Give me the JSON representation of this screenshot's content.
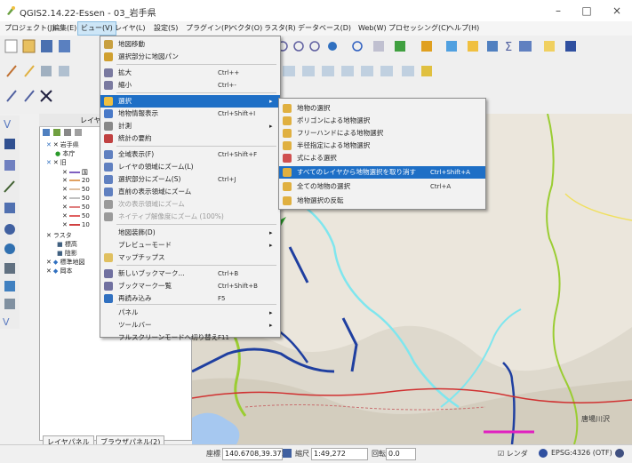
{
  "window": {
    "title": "QGIS2.14.22-Essen - 03_岩手県",
    "controls": [
      "–",
      "□",
      "×"
    ]
  },
  "menubar": [
    {
      "label": "プロジェクト(J)"
    },
    {
      "label": "編集(E)"
    },
    {
      "label": "ビュー(V)",
      "active": true
    },
    {
      "label": "レイヤ(L)"
    },
    {
      "label": "設定(S)"
    },
    {
      "label": "プラグイン(P)"
    },
    {
      "label": "ベクタ(O)"
    },
    {
      "label": "ラスタ(R)"
    },
    {
      "label": "データベース(D)"
    },
    {
      "label": "Web(W)"
    },
    {
      "label": "プロセッシング(C)"
    },
    {
      "label": "ヘルプ(H)"
    }
  ],
  "view_menu": {
    "items": [
      {
        "label": "地図移動",
        "icon": "pan-icon",
        "color": "#c8a040"
      },
      {
        "label": "選択部分に地図パン",
        "icon": "pan-selection-icon",
        "color": "#d0a030"
      },
      {
        "label": "拡大",
        "icon": "zoom-in-icon",
        "color": "#7a7aa0",
        "shortcut": "Ctrl++"
      },
      {
        "label": "縮小",
        "icon": "zoom-out-icon",
        "color": "#7a7aa0",
        "shortcut": "Ctrl+-"
      },
      {
        "label": "選択",
        "icon": "select-icon",
        "color": "#f0c040",
        "submenu": true,
        "highlighted": true
      },
      {
        "label": "地物情報表示",
        "icon": "identify-icon",
        "color": "#4a7ac8",
        "shortcut": "Ctrl+Shift+I"
      },
      {
        "label": "計測",
        "icon": "measure-icon",
        "color": "#888888",
        "submenu": true
      },
      {
        "label": "統計の要約",
        "icon": "sum-icon",
        "color": "#c04040"
      },
      {
        "label": "全域表示(F)",
        "icon": "full-extent-icon",
        "color": "#6080c0",
        "shortcut": "Ctrl+Shift+F"
      },
      {
        "label": "レイヤの領域にズーム(L)",
        "icon": "zoom-layer-icon",
        "color": "#6080c0"
      },
      {
        "label": "選択部分にズーム(S)",
        "icon": "zoom-selection-icon",
        "color": "#6080c0",
        "shortcut": "Ctrl+J"
      },
      {
        "label": "直前の表示領域にズーム",
        "icon": "zoom-last-icon",
        "color": "#6080c0"
      },
      {
        "label": "次の表示領域にズーム",
        "icon": "zoom-next-icon",
        "color": "#9a9a9a",
        "dim": true
      },
      {
        "label": "ネイティブ解像度にズーム (100%)",
        "icon": "zoom-native-icon",
        "color": "#9a9a9a",
        "dim": true
      },
      {
        "label": "地図装飾(D)",
        "icon": "",
        "color": "",
        "submenu": true
      },
      {
        "label": "プレビューモード",
        "icon": "",
        "color": "",
        "submenu": true
      },
      {
        "label": "マップチップス",
        "icon": "map-tips-icon",
        "color": "#e0c060"
      },
      {
        "label": "新しいブックマーク...",
        "icon": "new-bookmark-icon",
        "color": "#7070a0",
        "shortcut": "Ctrl+B"
      },
      {
        "label": "ブックマーク一覧",
        "icon": "bookmarks-icon",
        "color": "#7070a0",
        "shortcut": "Ctrl+Shift+B"
      },
      {
        "label": "再読み込み",
        "icon": "refresh-icon",
        "color": "#3070c0",
        "shortcut": "F5"
      },
      {
        "label": "パネル",
        "icon": "",
        "color": "",
        "submenu": true
      },
      {
        "label": "ツールバー",
        "icon": "",
        "color": "",
        "submenu": true
      },
      {
        "label": "フルスクリーンモードへ切り替え",
        "icon": "",
        "color": "",
        "shortcut": "F11"
      }
    ]
  },
  "select_submenu": {
    "items": [
      {
        "label": "地物の選択",
        "color": "#e0b040"
      },
      {
        "label": "ポリゴンによる地物選択",
        "color": "#e0b040"
      },
      {
        "label": "フリーハンドによる地物選択",
        "color": "#e0b040"
      },
      {
        "label": "半径指定による地物選択",
        "color": "#e0b040"
      },
      {
        "label": "式による選択",
        "color": "#d05050"
      },
      {
        "label": "すべてのレイヤから地物選択を取り消す",
        "color": "#e0b040",
        "shortcut": "Ctrl+Shift+A",
        "highlighted": true
      },
      {
        "label": "全ての地物の選択",
        "color": "#e0b040",
        "shortcut": "Ctrl+A"
      },
      {
        "label": "地物選択の反転",
        "color": "#e0b040"
      }
    ]
  },
  "layers_panel": {
    "title": "レイヤ",
    "rows": [
      {
        "label": "岩手県",
        "indent": 0,
        "color": ""
      },
      {
        "label": "本庁",
        "indent": 1,
        "color": "#2a9a2a"
      },
      {
        "label": "旧",
        "indent": 0,
        "color": ""
      },
      {
        "label": "国",
        "indent": 1,
        "color": "#8060c0"
      },
      {
        "label": "20",
        "indent": 1,
        "color": "#e0a060"
      },
      {
        "label": "50",
        "indent": 1,
        "color": "#e0c0a0"
      },
      {
        "label": "50",
        "indent": 1,
        "color": "#c0c0c0"
      },
      {
        "label": "50",
        "indent": 1,
        "color": "#e08080"
      },
      {
        "label": "50",
        "indent": 1,
        "color": "#e06060"
      },
      {
        "label": "10",
        "indent": 1,
        "color": "#d04040"
      },
      {
        "label": "ラスタ",
        "indent": 0,
        "color": ""
      },
      {
        "label": "標高",
        "indent": 1,
        "color": ""
      },
      {
        "label": "陰影",
        "indent": 1,
        "color": ""
      },
      {
        "label": "標準地図",
        "indent": 0,
        "color": ""
      },
      {
        "label": "岡本",
        "indent": 0,
        "color": ""
      }
    ]
  },
  "bottom_tabs": [
    "レイヤパネル",
    "ブラウザパネル(2)"
  ],
  "statusbar": {
    "coord_label": "座標",
    "coord_value": "140.6708,39.3714",
    "scale_label": "縮尺",
    "scale_value": "1:49,272",
    "rotation_label": "回転",
    "rotation_value": "0.0",
    "render_label": "レンダ",
    "crs": "EPSG:4326 (OTF)"
  },
  "map_labels": [
    "唐場川沢"
  ],
  "colors": {
    "highlight": "#1e6fc6",
    "menu_active": "#cde6f7",
    "river_dark": "#1f3fa0",
    "river_light": "#7fe6ee",
    "boundary": "#9acd32",
    "road_red": "#d03030",
    "road_magenta": "#e020c0"
  }
}
